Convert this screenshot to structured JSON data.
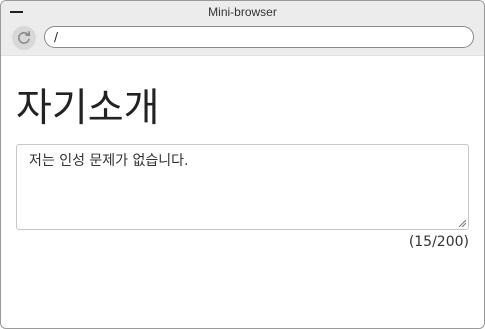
{
  "window": {
    "title": "Mini-browser"
  },
  "toolbar": {
    "reload_icon": "reload-icon",
    "address_value": "/"
  },
  "page": {
    "heading": "자기소개",
    "textarea_value": "저는 인성 문제가 없습니다.",
    "counter": "(15/200)"
  }
}
